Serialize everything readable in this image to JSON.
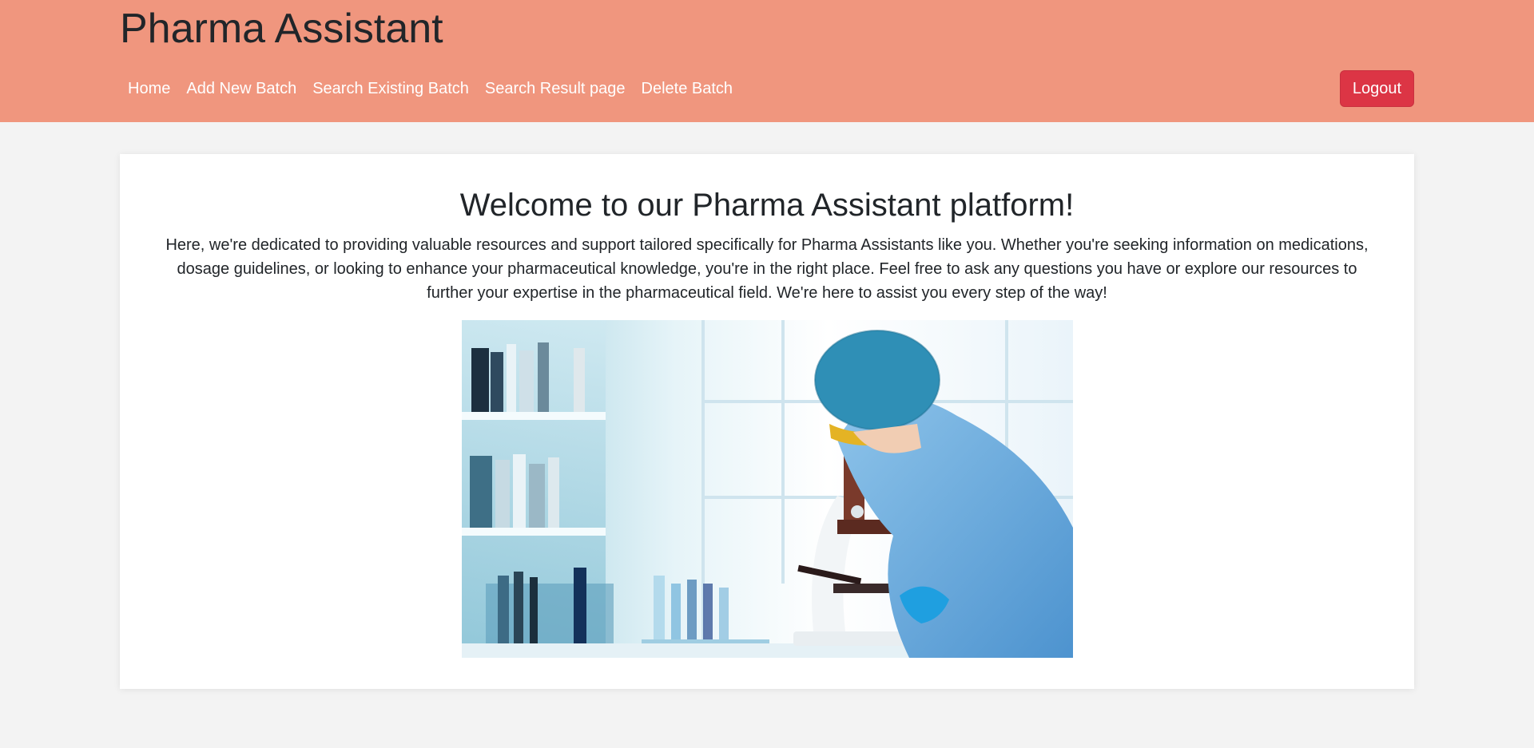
{
  "app": {
    "brand": "Pharma Assistant"
  },
  "nav": {
    "items": [
      {
        "label": "Home"
      },
      {
        "label": "Add New Batch"
      },
      {
        "label": "Search Existing Batch"
      },
      {
        "label": "Search Result page"
      },
      {
        "label": "Delete Batch"
      }
    ],
    "logout_label": "Logout"
  },
  "main": {
    "heading": "Welcome to our Pharma Assistant platform!",
    "intro": "Here, we're dedicated to providing valuable resources and support tailored specifically for Pharma Assistants like you. Whether you're seeking information on medications, dosage guidelines, or looking to enhance your pharmaceutical knowledge, you're in the right place. Feel free to ask any questions you have or explore our resources to further your expertise in the pharmaceutical field. We're here to assist you every step of the way!"
  },
  "colors": {
    "header_bg": "#f0967e",
    "logout_bg": "#dc3545",
    "page_bg": "#f3f3f3"
  }
}
